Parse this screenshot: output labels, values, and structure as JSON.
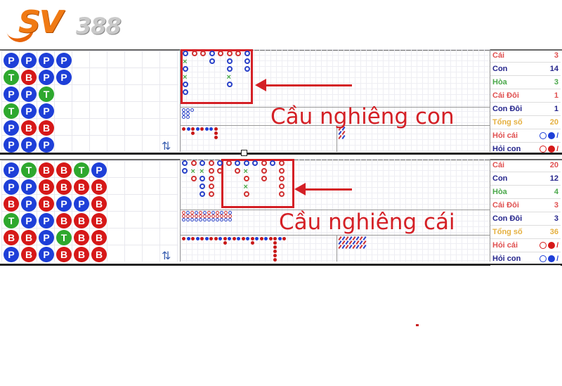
{
  "brand": {
    "name_part1": "SV",
    "name_part2": "388"
  },
  "colors": {
    "player": "#1e3fd8",
    "banker": "#d61818",
    "tie": "#2ea82e",
    "annotation": "#d42026"
  },
  "boards": [
    {
      "id": "board-con",
      "bead_plate": [
        [
          "P",
          "P",
          "P",
          "P"
        ],
        [
          "T",
          "B",
          "P",
          "P"
        ],
        [
          "P",
          "P",
          "T"
        ],
        [
          "T",
          "P",
          "P"
        ],
        [
          "P",
          "B",
          "B"
        ],
        [
          "P",
          "P",
          "P"
        ]
      ],
      "caption": "Cầu nghiêng con",
      "stats": [
        {
          "label": "Cái",
          "value": "3",
          "color": "red"
        },
        {
          "label": "Con",
          "value": "14",
          "color": "blue"
        },
        {
          "label": "Hòa",
          "value": "3",
          "color": "green"
        },
        {
          "label": "Cái Đôi",
          "value": "1",
          "color": "red"
        },
        {
          "label": "Con Đôi",
          "value": "1",
          "color": "blue"
        },
        {
          "label": "Tổng số",
          "value": "20",
          "color": "orange"
        }
      ],
      "ask": [
        {
          "label": "Hỏi cái",
          "color": "red",
          "ring": "blue",
          "dot": "blue"
        },
        {
          "label": "Hỏi con",
          "color": "blue",
          "ring": "red",
          "dot": "red"
        }
      ]
    },
    {
      "id": "board-cai",
      "bead_plate": [
        [
          "P",
          "T",
          "B",
          "B",
          "T",
          "P"
        ],
        [
          "P",
          "P",
          "B",
          "B",
          "B",
          "B"
        ],
        [
          "B",
          "P",
          "B",
          "P",
          "P",
          "B"
        ],
        [
          "T",
          "P",
          "P",
          "B",
          "B",
          "B"
        ],
        [
          "B",
          "B",
          "P",
          "T",
          "B",
          "B"
        ],
        [
          "P",
          "B",
          "P",
          "B",
          "B",
          "B"
        ]
      ],
      "caption": "Cầu nghiêng cái",
      "stats": [
        {
          "label": "Cái",
          "value": "20",
          "color": "red"
        },
        {
          "label": "Con",
          "value": "12",
          "color": "blue"
        },
        {
          "label": "Hòa",
          "value": "4",
          "color": "green"
        },
        {
          "label": "Cái Đôi",
          "value": "3",
          "color": "red"
        },
        {
          "label": "Con Đôi",
          "value": "3",
          "color": "blue"
        },
        {
          "label": "Tổng số",
          "value": "36",
          "color": "orange"
        }
      ],
      "ask": [
        {
          "label": "Hỏi cái",
          "color": "red",
          "ring": "red",
          "dot": "red"
        },
        {
          "label": "Hỏi con",
          "color": "blue",
          "ring": "blue",
          "dot": "blue"
        }
      ]
    }
  ],
  "big_road_1": {
    "columns": [
      [
        "b",
        "x",
        "b",
        "x",
        "b",
        "b"
      ],
      [
        "r"
      ],
      [
        "r"
      ],
      [
        "b",
        "b"
      ],
      [
        "r"
      ],
      [
        "r",
        "b",
        "b",
        "x",
        "b"
      ],
      [
        "r"
      ],
      [
        "b",
        "b",
        "b"
      ]
    ]
  },
  "big_road_2": {
    "columns": [
      [
        "b",
        "b"
      ],
      [
        "r",
        "x",
        "r"
      ],
      [
        "b",
        "x",
        "b",
        "b",
        "b"
      ],
      [
        "r",
        "r",
        "r",
        "r",
        "r"
      ],
      [
        "b",
        "r"
      ],
      [
        "r"
      ],
      [
        "b",
        "r"
      ],
      [
        "b",
        "x",
        "r",
        "x",
        "r"
      ],
      [
        "b"
      ],
      [
        "r",
        "r",
        "r"
      ],
      [
        "b"
      ],
      [
        "r",
        "r",
        "r",
        "r",
        "r"
      ]
    ]
  },
  "icons": {
    "swap": "⇅"
  }
}
